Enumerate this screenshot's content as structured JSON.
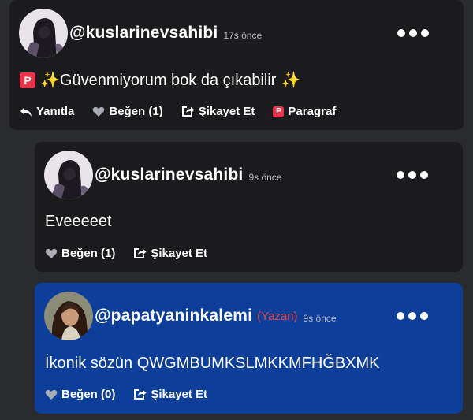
{
  "posts": [
    {
      "username": "@kuslarinevsahibi",
      "time": "17s önce",
      "text": "✨Güvenmiyorum bok da çıkabilir",
      "sparkle_end": "✨",
      "actions": {
        "reply": "Yanıtla",
        "like": "Beğen (1)",
        "report": "Şikayet Et",
        "paragraph": "Paragraf"
      }
    },
    {
      "username": "@kuslarinevsahibi",
      "time": "9s önce",
      "text": "Eveeeeet",
      "actions": {
        "like": "Beğen (1)",
        "report": "Şikayet Et"
      }
    },
    {
      "username": "@papatyaninkalemi",
      "author_tag": "(Yazan)",
      "time": "9s önce",
      "text": "İkonik sözün QWGMBUMKSLMKKMFHĞBXMK",
      "actions": {
        "like": "Beğen (0)",
        "report": "Şikayet Et"
      }
    }
  ],
  "colors": {
    "background": "#2a2b2f",
    "card_dark": "#1b1b1d",
    "card_highlight": "#0d3e9a",
    "author_tag": "#e04848",
    "paragraph_badge": "#e8334a"
  },
  "icons": [
    "reply-icon",
    "heart-icon",
    "report-icon",
    "paragraph-icon",
    "more-icon",
    "sparkle-icon"
  ]
}
